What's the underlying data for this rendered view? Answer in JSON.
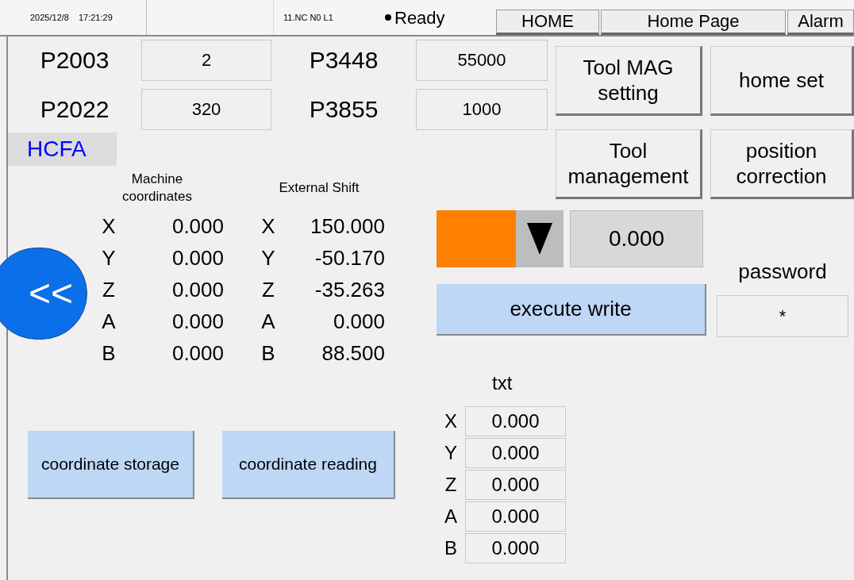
{
  "status_bar": {
    "date": "2025/12/8",
    "time": "17:21:29",
    "program": "11.NC N0 L1",
    "state": "Ready"
  },
  "nav_buttons": [
    "HOME",
    "Home Page",
    "Alarm"
  ],
  "params": [
    {
      "name": "P2003",
      "value": "2"
    },
    {
      "name": "P3448",
      "value": "55000"
    },
    {
      "name": "P2022",
      "value": "320"
    },
    {
      "name": "P3855",
      "value": "1000"
    }
  ],
  "brand": "HCFA",
  "back_button": "<<",
  "coordinate_headers": [
    "Machine coordinates",
    "External Shift"
  ],
  "coordinates": [
    {
      "axis": "X",
      "machine": "0.000",
      "shift_axis": "X",
      "shift": "150.000"
    },
    {
      "axis": "Y",
      "machine": "0.000",
      "shift_axis": "Y",
      "shift": "-50.170"
    },
    {
      "axis": "Z",
      "machine": "0.000",
      "shift_axis": "Z",
      "shift": "-35.263"
    },
    {
      "axis": "A",
      "machine": "0.000",
      "shift_axis": "A",
      "shift": "0.000"
    },
    {
      "axis": "B",
      "machine": "0.000",
      "shift_axis": "B",
      "shift": "88.500"
    }
  ],
  "function_buttons": [
    "Tool MAG setting",
    "home set",
    "Tool management",
    "position correction"
  ],
  "selector": {
    "color": "#ff8000",
    "value": "0.000"
  },
  "execute_button": "execute write",
  "password": {
    "label": "password",
    "value": "*"
  },
  "coordinate_buttons": [
    "coordinate storage",
    "coordinate reading"
  ],
  "txt": {
    "label": "txt",
    "rows": [
      {
        "axis": "X",
        "value": "0.000"
      },
      {
        "axis": "Y",
        "value": "0.000"
      },
      {
        "axis": "Z",
        "value": "0.000"
      },
      {
        "axis": "A",
        "value": "0.000"
      },
      {
        "axis": "B",
        "value": "0.000"
      }
    ]
  }
}
